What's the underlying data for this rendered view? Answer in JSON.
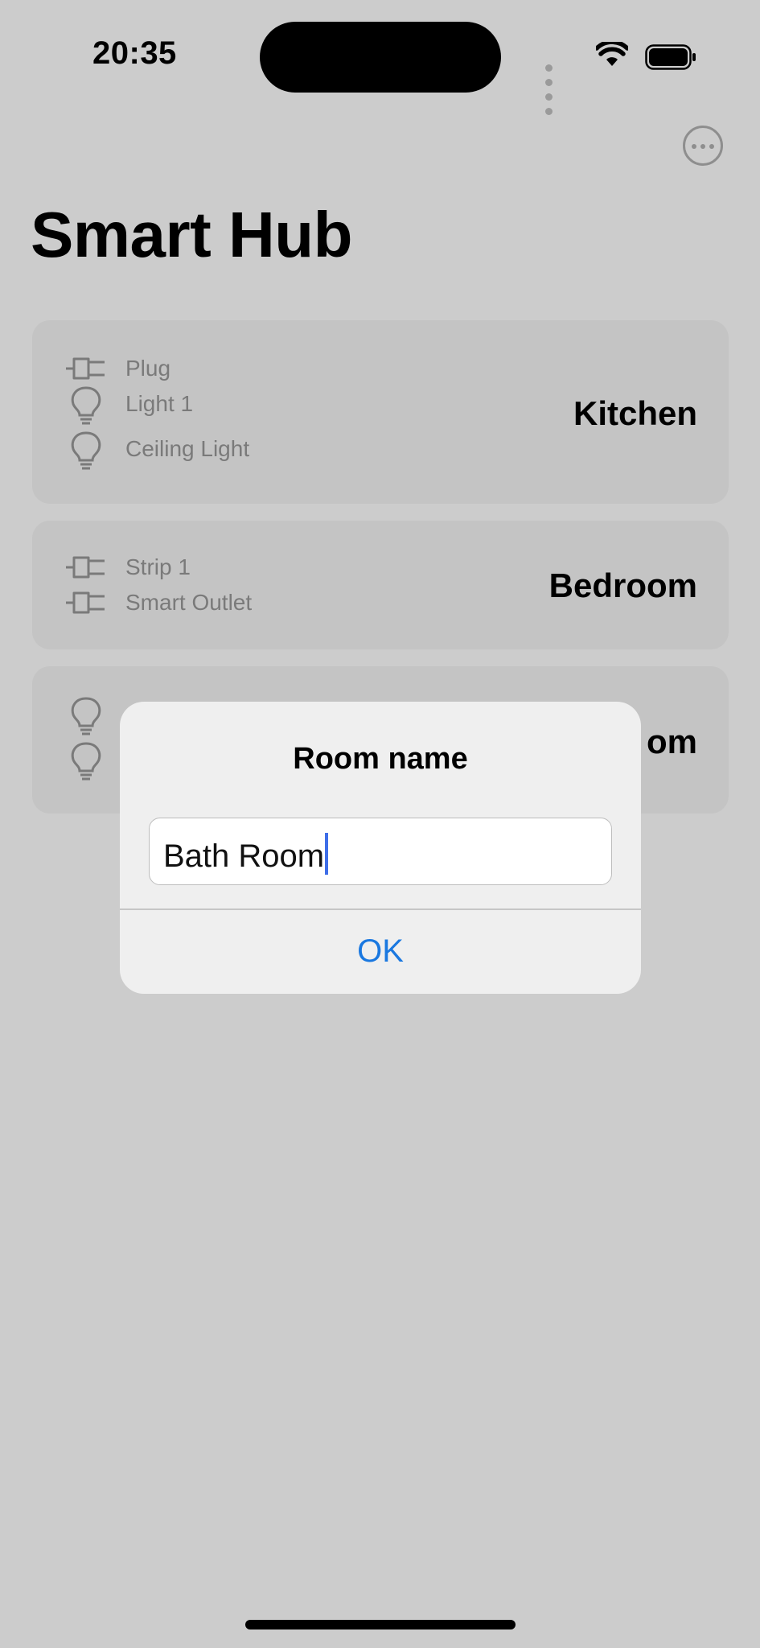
{
  "status_bar": {
    "time": "20:35"
  },
  "header": {
    "title": "Smart Hub",
    "more_icon": "ellipsis-circle-icon"
  },
  "rooms": [
    {
      "name": "Kitchen",
      "devices": [
        {
          "label": "Plug",
          "icon": "plug-icon"
        },
        {
          "label": "Light 1",
          "icon": "lightbulb-icon"
        },
        {
          "label": "Ceiling Light",
          "icon": "lightbulb-icon"
        }
      ]
    },
    {
      "name": "Bedroom",
      "devices": [
        {
          "label": "Strip 1",
          "icon": "plug-icon"
        },
        {
          "label": "Smart Outlet",
          "icon": "plug-icon"
        }
      ]
    },
    {
      "name": "om",
      "devices": [
        {
          "icon": "lightbulb-icon"
        },
        {
          "icon": "lightbulb-icon"
        }
      ]
    }
  ],
  "dialog": {
    "title": "Room name",
    "input_value": "Bath Room",
    "ok_label": "OK"
  },
  "colors": {
    "accent": "#1a78e0",
    "caret": "#3e6ee8",
    "overlay_bg": "#cccccc"
  }
}
